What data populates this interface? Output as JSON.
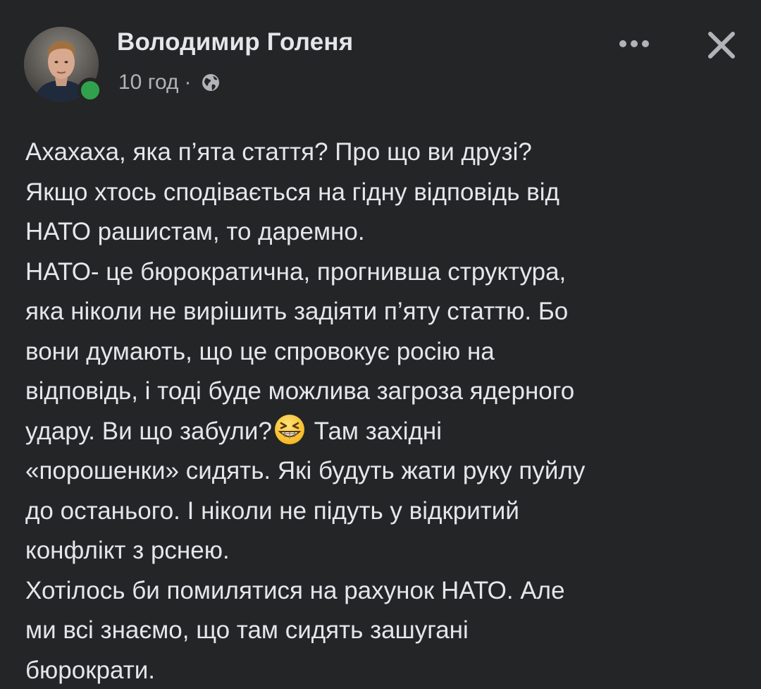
{
  "post": {
    "author": {
      "name": "Володимир Голеня",
      "online": true
    },
    "timestamp": "10 год",
    "separator": "·",
    "audience_icon": "globe-icon",
    "actions": {
      "more_icon": "more-horizontal-icon",
      "close_icon": "close-icon"
    },
    "lines": [
      "Ахахаха, яка п’ята стаття? Про що ви друзі?",
      "Якщо хтось сподівається на гідну відповідь від",
      "НАТО рашистам, то даремно.",
      "НАТО- це бюрократична, прогнивша структура,",
      "яка ніколи не вирішить задіяти п’яту статтю. Бо",
      "вони думають, що це спровокує росію на",
      "відповідь, і тоді буде можлива загроза ядерного",
      {
        "before": "удару. Ви що забули?",
        "emoji": "grinning-squinting-face-emoji",
        "after": " Там західні"
      },
      "«порошенки» сидять. Які будуть жати руку пуйлу",
      "до останього. І ніколи не підуть у відкритий",
      "конфлікт з рснею.",
      "Хотілось би помилятися на рахунок НАТО. Але",
      "ми всі знаємо, що там сидять зашугані",
      "бюрократи."
    ]
  },
  "colors": {
    "background": "#242526",
    "primary_text": "#e4e6eb",
    "secondary_text": "#b0b3b8",
    "online": "#31a24c"
  }
}
